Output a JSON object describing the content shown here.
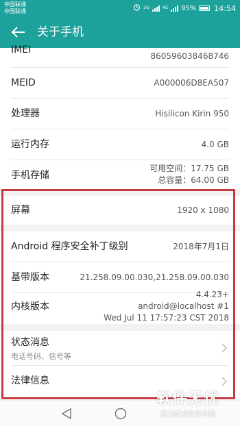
{
  "status_bar": {
    "carrier_1": "中国联通",
    "carrier_2": "中国联通",
    "net_1": "2G",
    "net_2": "4G",
    "battery": "95%",
    "time": "14:54"
  },
  "app_bar": {
    "title": "关于手机"
  },
  "items": {
    "imei": {
      "label": "IMEI",
      "value": "860596038468746"
    },
    "meid": {
      "label": "MEID",
      "value": "A000006D8EA507"
    },
    "processor": {
      "label": "处理器",
      "value": "Hisilicon Kirin 950"
    },
    "ram": {
      "label": "运行内存",
      "value": "4.0 GB"
    },
    "storage": {
      "label": "手机存储",
      "value_line1": "可用空间：17.75  GB",
      "value_line2": "总容量：64.00  GB"
    },
    "screen": {
      "label": "屏幕",
      "value": "1920 x 1080"
    },
    "security_patch": {
      "label": "Android 程序安全补丁级别",
      "value": "2018年7月1日"
    },
    "baseband": {
      "label": "基带版本",
      "value": "21.258.09.00.030,21.258.09.00.030"
    },
    "kernel": {
      "label": "内核版本",
      "value_line1": "4.4.23+",
      "value_line2": "android@localhost #1",
      "value_line3": "Wed Jul 11 17:57:23 CST 2018"
    },
    "status_info": {
      "label": "状态消息",
      "sub": "电话号码、信号等"
    },
    "legal": {
      "label": "法律信息"
    }
  },
  "watermark": {
    "main": "软件无忧",
    "sub": "努力解决软件问题"
  },
  "colors": {
    "accent": "#1ca19b",
    "highlight_border": "#c43b40"
  },
  "icons": {
    "back": "arrow-left-icon",
    "chevron": "chevron-right-icon",
    "nav_back": "triangle-back-icon",
    "nav_home": "circle-home-icon"
  }
}
